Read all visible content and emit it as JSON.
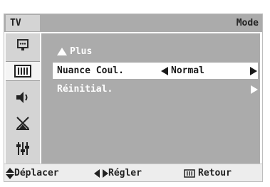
{
  "header": {
    "tv_label": "TV",
    "title": "Mode"
  },
  "sidebar": {
    "icons": [
      {
        "name": "input-icon"
      },
      {
        "name": "picture-icon"
      },
      {
        "name": "sound-icon"
      },
      {
        "name": "channel-icon"
      },
      {
        "name": "setup-icon"
      }
    ],
    "active_index": 1
  },
  "menu": {
    "back_label": "Plus",
    "items": [
      {
        "label": "Nuance Coul.",
        "value": "Normal"
      },
      {
        "label": "Réinitial."
      }
    ],
    "selected_index": 0
  },
  "footer": {
    "move": "Déplacer",
    "adjust": "Régler",
    "return": "Retour"
  }
}
